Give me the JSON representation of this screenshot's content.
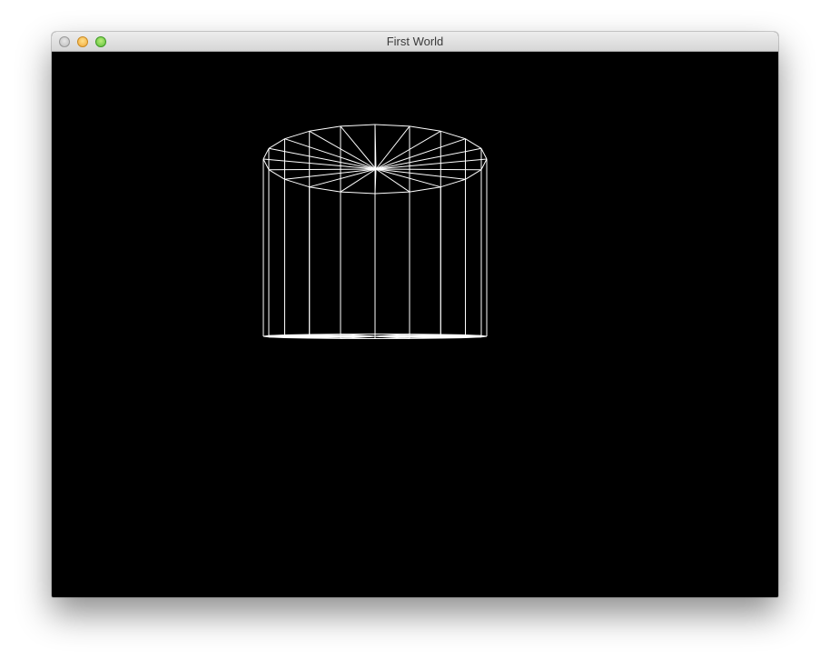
{
  "window": {
    "title": "First World"
  },
  "controls": {
    "close": "close-button",
    "minimize": "minimize-button",
    "zoom": "zoom-button"
  },
  "scene": {
    "background_color": "#000000",
    "wire_color": "#ffffff",
    "object": "cylinder",
    "render_mode": "wireframe",
    "segments": 20
  }
}
